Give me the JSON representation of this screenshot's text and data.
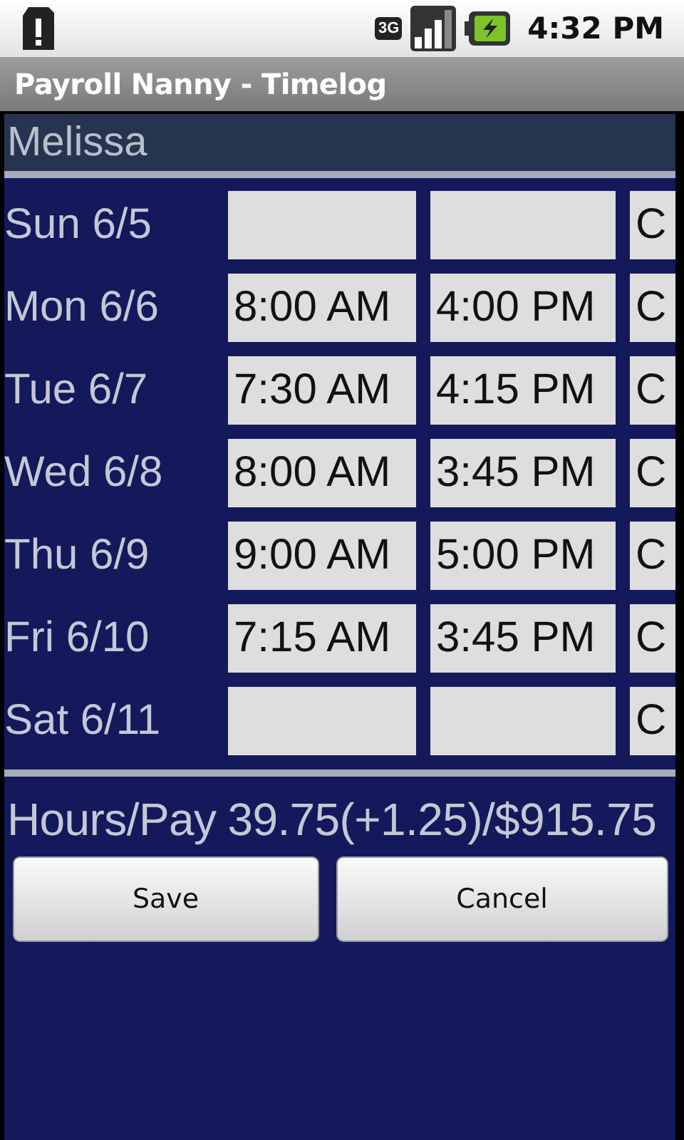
{
  "status_bar": {
    "network": "3G",
    "time": "4:32 PM"
  },
  "title_bar": {
    "title": "Payroll Nanny - Timelog"
  },
  "employee": {
    "name": "Melissa"
  },
  "days": [
    {
      "label": "Sun 6/5",
      "action": "C"
    },
    {
      "label": "Mon 6/6",
      "time_in": "8:00 AM",
      "time_out": "4:00 PM",
      "action": "C"
    },
    {
      "label": "Tue 6/7",
      "time_in": "7:30 AM",
      "time_out": "4:15 PM",
      "action": "C"
    },
    {
      "label": "Wed 6/8",
      "time_in": "8:00 AM",
      "time_out": "3:45 PM",
      "action": "C"
    },
    {
      "label": "Thu 6/9",
      "time_in": "9:00 AM",
      "time_out": "5:00 PM",
      "action": "C"
    },
    {
      "label": "Fri 6/10",
      "time_in": "7:15 AM",
      "time_out": "3:45 PM",
      "action": "C"
    },
    {
      "label": "Sat 6/11",
      "action": "C"
    }
  ],
  "summary": {
    "label": "Hours/Pay",
    "value": "39.75(+1.25)/$915.75"
  },
  "buttons": [
    "Save",
    "Cancel"
  ]
}
